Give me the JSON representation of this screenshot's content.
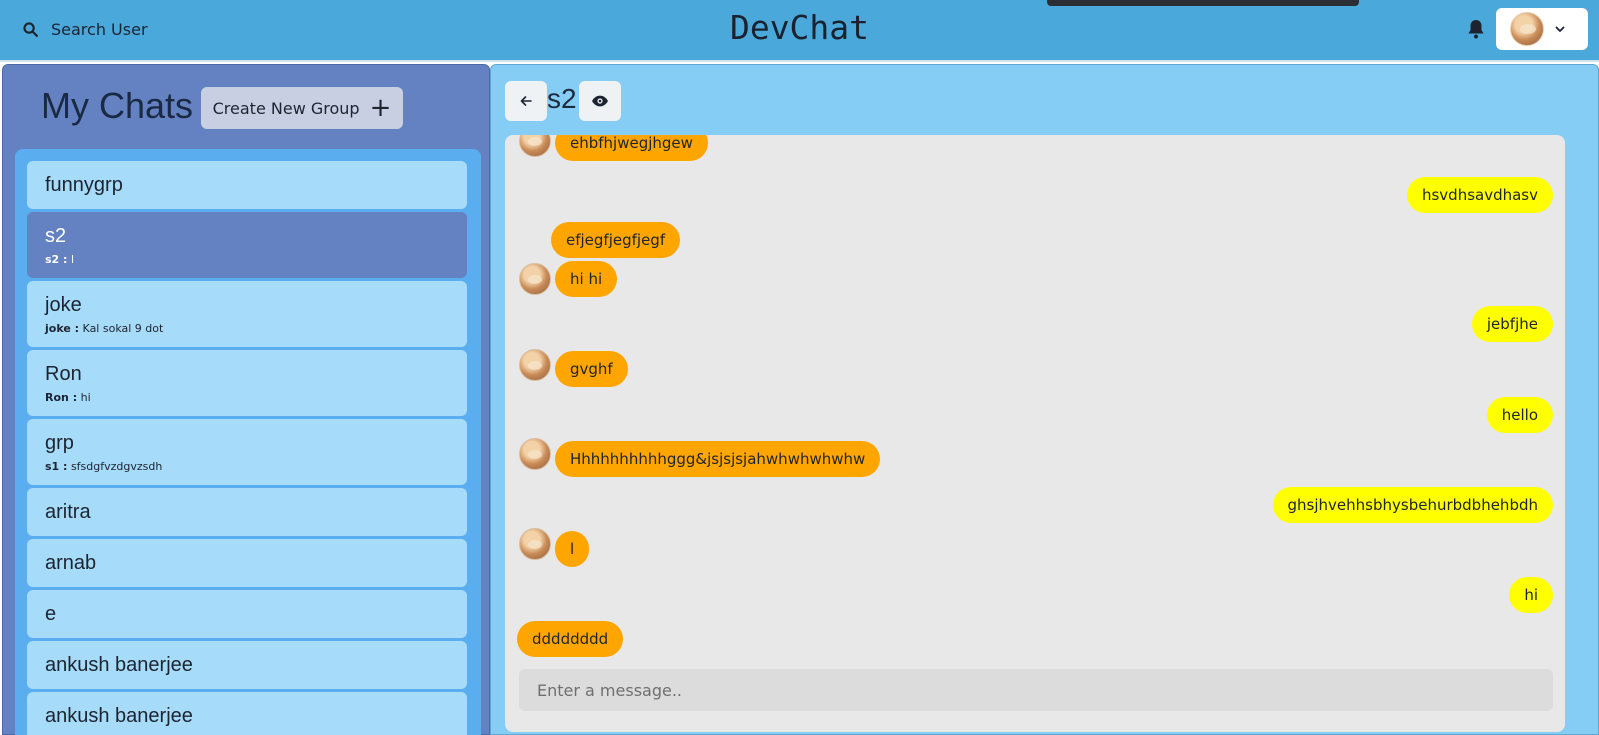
{
  "header": {
    "search_label": "Search User",
    "title": "DevChat",
    "icons": {
      "search": "search-icon",
      "bell": "bell-icon",
      "chevron": "chevron-down-icon"
    }
  },
  "sidebar": {
    "heading": "My Chats",
    "new_group_label": "Create New Group",
    "new_group_icon": "+",
    "chats": [
      {
        "name": "funnygrp",
        "sender": "",
        "last": ""
      },
      {
        "name": "s2",
        "sender": "s2 :",
        "last": "l",
        "active": true
      },
      {
        "name": "joke",
        "sender": "joke :",
        "last": "Kal sokal 9 dot"
      },
      {
        "name": "Ron",
        "sender": "Ron :",
        "last": "hi"
      },
      {
        "name": "grp",
        "sender": "s1 :",
        "last": "sfsdgfvzdgvzsdh"
      },
      {
        "name": "aritra",
        "sender": "",
        "last": ""
      },
      {
        "name": "arnab",
        "sender": "",
        "last": ""
      },
      {
        "name": "e",
        "sender": "",
        "last": ""
      },
      {
        "name": "ankush banerjee",
        "sender": "",
        "last": ""
      },
      {
        "name": "ankush banerjee",
        "sender": "",
        "last": ""
      }
    ]
  },
  "chat": {
    "title": "s2",
    "back_icon": "arrow-left-icon",
    "view_icon": "eye-icon",
    "messages": [
      {
        "text": "ehbfhjwegjhgew",
        "side": "left"
      },
      {
        "text": "hsvdhsavdhasv",
        "side": "right"
      },
      {
        "text": "efjegfjegfjegf",
        "side": "left"
      },
      {
        "text": "hi hi",
        "side": "left"
      },
      {
        "text": "jebfjhe",
        "side": "right"
      },
      {
        "text": "gvghf",
        "side": "left"
      },
      {
        "text": "hello",
        "side": "right"
      },
      {
        "text": "Hhhhhhhhhhggg&jsjsjsjahwhwhwhwhw",
        "side": "left"
      },
      {
        "text": "ghsjhvehhsbhysbehurbdbhehbdh",
        "side": "right"
      },
      {
        "text": "l",
        "side": "left"
      },
      {
        "text": "hi",
        "side": "right"
      },
      {
        "text": "dddddddd",
        "side": "left"
      }
    ],
    "input_placeholder": "Enter a message.."
  },
  "colors": {
    "header_bg": "#4aa8da",
    "left_panel": "#6482c1",
    "chat_item": "#a7dbfa",
    "right_panel": "#86cdf6",
    "incoming_bubble": "#ffa500",
    "outgoing_bubble": "#ffff00"
  }
}
